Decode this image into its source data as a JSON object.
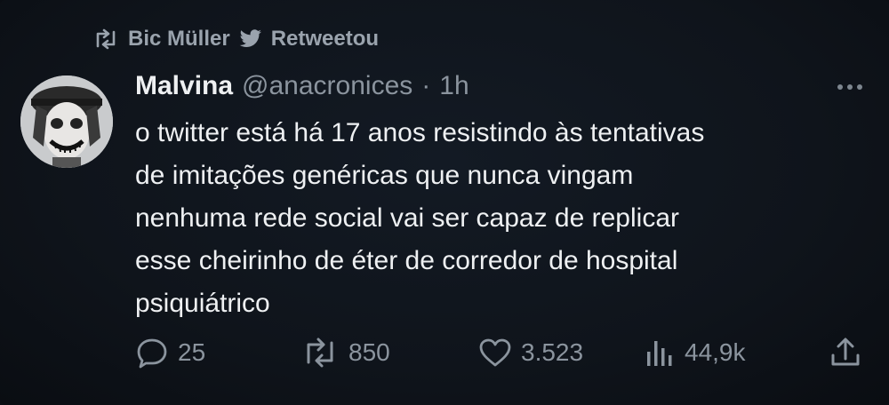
{
  "retweet": {
    "icon": "retweet-icon",
    "user": "Bic Müller",
    "bird_icon": "twitter-bird-icon",
    "label": "Retweetou"
  },
  "tweet": {
    "avatar": "avatar",
    "display_name": "Malvina",
    "handle": "@anacronices",
    "separator": "·",
    "time": "1h",
    "more_icon": "more-dots-icon",
    "lines": [
      "o twitter está há 17 anos resistindo às tentativas",
      "de imitações genéricas que nunca vingam",
      "nenhuma rede social vai ser capaz de replicar",
      "esse cheirinho de éter de corredor de hospital",
      "psiquiátrico"
    ]
  },
  "actions": {
    "replies": {
      "icon": "reply-icon",
      "count": "25"
    },
    "retweets": {
      "icon": "retweet-icon",
      "count": "850"
    },
    "likes": {
      "icon": "heart-icon",
      "count": "3.523"
    },
    "views": {
      "icon": "views-bar-icon",
      "count": "44,9k"
    },
    "share": {
      "icon": "share-icon"
    }
  },
  "colors": {
    "background": "#0f141b",
    "text": "#eef0f2",
    "secondary": "#8b949e"
  }
}
